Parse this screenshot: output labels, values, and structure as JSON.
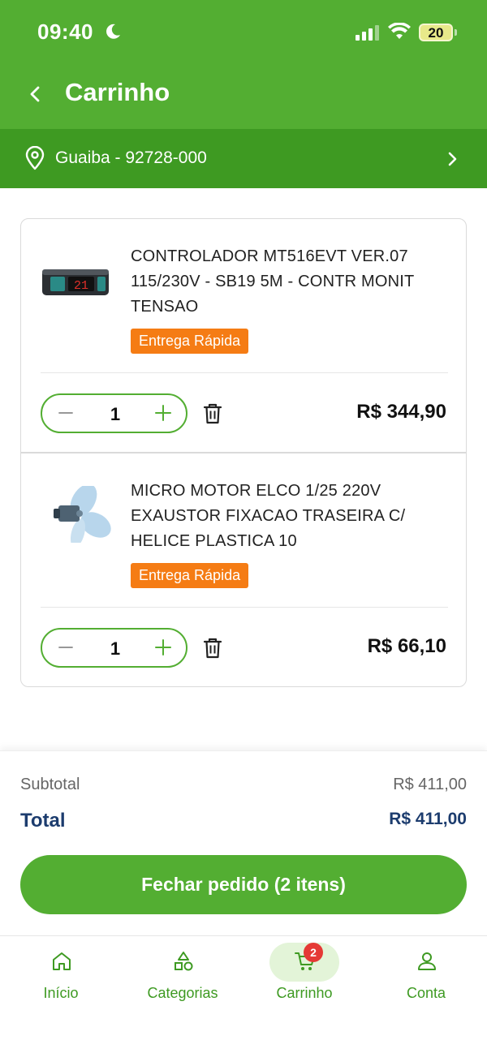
{
  "status_bar": {
    "time": "09:40",
    "battery": "20"
  },
  "header": {
    "title": "Carrinho"
  },
  "location": {
    "text": "Guaiba - 92728-000"
  },
  "cart": {
    "items": [
      {
        "name": "CONTROLADOR MT516EVT VER.07 115/230V - SB19 5M - CONTR MONIT TENSAO",
        "badge": "Entrega Rápida",
        "quantity": "1",
        "price": "R$ 344,90",
        "image": "thermostat-controller-image"
      },
      {
        "name": "MICRO MOTOR ELCO 1/25 220V EXAUSTOR FIXACAO TRASEIRA C/ HELICE PLASTICA 10",
        "badge": "Entrega Rápida",
        "quantity": "1",
        "price": "R$ 66,10",
        "image": "fan-motor-image"
      }
    ]
  },
  "summary": {
    "subtotal_label": "Subtotal",
    "subtotal_value": "R$ 411,00",
    "total_label": "Total",
    "total_value": "R$ 411,00",
    "checkout_label": "Fechar pedido (2 itens)"
  },
  "nav": {
    "items": [
      {
        "label": "Início",
        "icon": "home-icon"
      },
      {
        "label": "Categorias",
        "icon": "categories-icon"
      },
      {
        "label": "Carrinho",
        "icon": "cart-icon",
        "active": true,
        "badge": "2"
      },
      {
        "label": "Conta",
        "icon": "user-icon"
      }
    ]
  },
  "colors": {
    "brand_green": "#53ae32",
    "location_bar": "#3e9a22",
    "badge_orange": "#f57c14",
    "total_blue": "#1c3c6e",
    "cart_badge_red": "#e53935"
  }
}
